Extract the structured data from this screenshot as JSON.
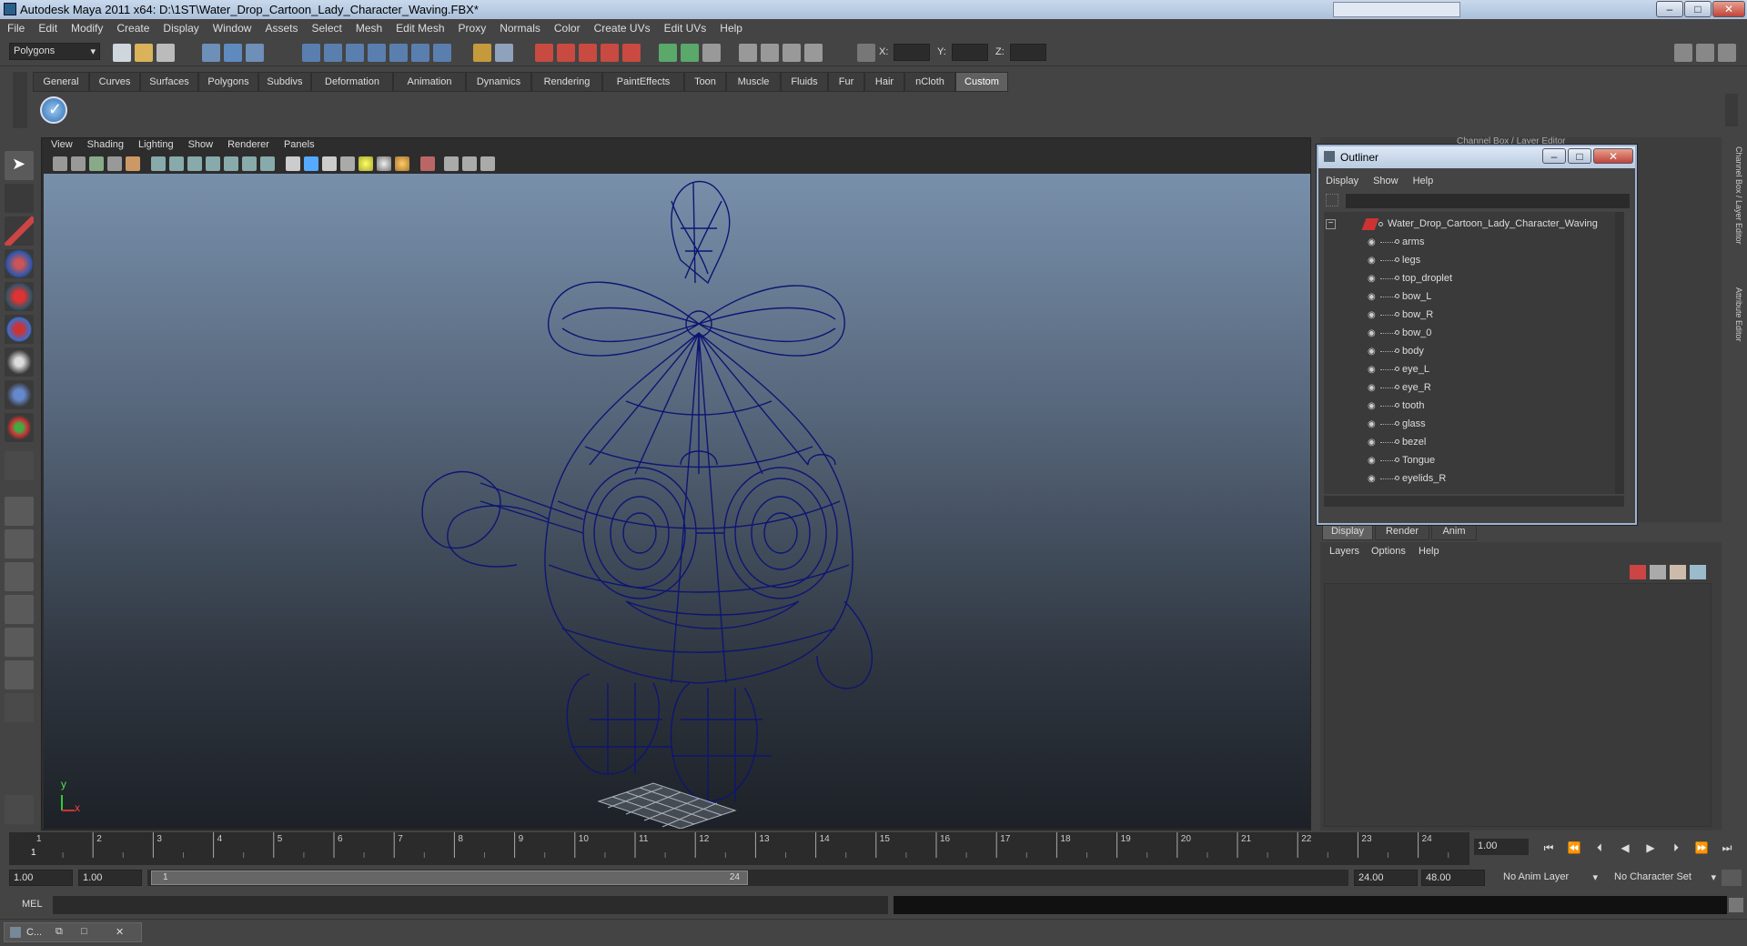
{
  "window": {
    "title": "Autodesk Maya 2011 x64: D:\\1ST\\Water_Drop_Cartoon_Lady_Character_Waving.FBX*",
    "min": "–",
    "max": "□",
    "close": "✕"
  },
  "menubar": [
    "File",
    "Edit",
    "Modify",
    "Create",
    "Display",
    "Window",
    "Assets",
    "Select",
    "Mesh",
    "Edit Mesh",
    "Proxy",
    "Normals",
    "Color",
    "Create UVs",
    "Edit UVs",
    "Help"
  ],
  "toolbar": {
    "mode": "Polygons",
    "x_label": "X:",
    "y_label": "Y:",
    "z_label": "Z:"
  },
  "shelf_tabs": [
    "General",
    "Curves",
    "Surfaces",
    "Polygons",
    "Subdivs",
    "Deformation",
    "Animation",
    "Dynamics",
    "Rendering",
    "PaintEffects",
    "Toon",
    "Muscle",
    "Fluids",
    "Fur",
    "Hair",
    "nCloth",
    "Custom"
  ],
  "shelf_active": "Custom",
  "viewport": {
    "menu": [
      "View",
      "Shading",
      "Lighting",
      "Show",
      "Renderer",
      "Panels"
    ],
    "axis_y": "y",
    "axis_x": "x",
    "colors": {
      "wire": "#0d1572"
    }
  },
  "channel_box_title": "Channel Box / Layer Editor",
  "outliner": {
    "title": "Outliner",
    "menu": [
      "Display",
      "Show",
      "Help"
    ],
    "root": "Water_Drop_Cartoon_Lady_Character_Waving",
    "children": [
      "arms",
      "legs",
      "top_droplet",
      "bow_L",
      "bow_R",
      "bow_0",
      "body",
      "eye_L",
      "eye_R",
      "tooth",
      "glass",
      "bezel",
      "Tongue",
      "eyelids_R"
    ],
    "expand": "−"
  },
  "layer_editor": {
    "tabs": [
      "Display",
      "Render",
      "Anim"
    ],
    "active": "Display",
    "menu": [
      "Layers",
      "Options",
      "Help"
    ]
  },
  "side_labels": [
    "Channel Box / Layer Editor",
    "Attribute Editor"
  ],
  "timeline": {
    "frames": [
      "1",
      "2",
      "3",
      "4",
      "5",
      "6",
      "7",
      "8",
      "9",
      "10",
      "11",
      "12",
      "13",
      "14",
      "15",
      "16",
      "17",
      "18",
      "19",
      "20",
      "21",
      "22",
      "23",
      "24"
    ],
    "current": "1",
    "current_frame_field": "1.00"
  },
  "range": {
    "start": "1.00",
    "playstart": "1.00",
    "slider_start": "1",
    "slider_end": "24",
    "playend": "24.00",
    "end": "48.00",
    "anim_layer": "No Anim Layer",
    "char_set": "No Character Set"
  },
  "command": {
    "label": "MEL"
  },
  "taskbar": {
    "item": "C..."
  }
}
